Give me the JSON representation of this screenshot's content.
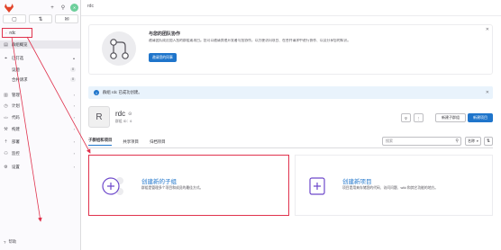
{
  "topbar": {
    "avatar_text": "✕"
  },
  "sidebar": {
    "tabs": [
      "▢",
      "⇅",
      "✉"
    ],
    "project_name": "rdc",
    "items": [
      {
        "label": "群组概览",
        "icon": "▤",
        "active": true
      },
      {
        "label": "已钉选",
        "icon": "⌖",
        "expanded": true
      },
      {
        "sub": true,
        "label": "议题",
        "badge": "0"
      },
      {
        "sub": true,
        "label": "合并请求",
        "badge": "0"
      },
      {
        "label": "管理",
        "icon": "▥"
      },
      {
        "label": "计划",
        "icon": "◷"
      },
      {
        "label": "代码",
        "icon": "</>"
      },
      {
        "label": "构建",
        "icon": "⚒"
      },
      {
        "label": "部署",
        "icon": "⇡"
      },
      {
        "label": "监控",
        "icon": "⚇"
      },
      {
        "label": "设置",
        "icon": "⚙"
      }
    ],
    "help_label": "帮助"
  },
  "breadcrumb": "rdc",
  "invite_card": {
    "title": "与您的团队协作",
    "text": "邀请团队成员加入您的群组或项目。您可以邀请其他开发者与您协作，以方便访问项目、在合并请求中进行协作、以及分享您的知识。",
    "button": "邀请您的同事"
  },
  "alert": {
    "text": "群组 rdc 已成功创建。"
  },
  "group": {
    "avatar_letter": "R",
    "name": "rdc",
    "id_label": "群组 ID：6",
    "new_subgroup": "新建子群组",
    "new_project": "新建项目"
  },
  "tabs": [
    "子群组和项目",
    "共享项目",
    "归档项目"
  ],
  "search_placeholder": "搜索",
  "sort_label": "名称",
  "cards": {
    "subgroup": {
      "title": "创建新的子组",
      "desc": "群组是管理多个项目和成员的最佳方式。"
    },
    "project": {
      "title": "创建新项目",
      "desc": "项目是用来存储您的代码、访问问题、wiki 和其它功能的地方。"
    }
  },
  "colors": {
    "accent": "#1f75cb",
    "highlight": "#e0324d"
  }
}
